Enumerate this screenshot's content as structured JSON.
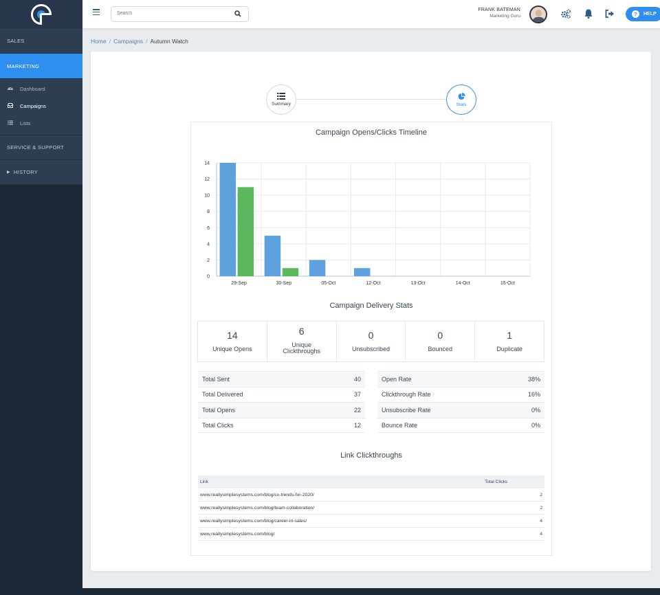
{
  "sidebar": {
    "sections": {
      "sales": "SALES",
      "marketing": "MARKETING",
      "service": "SERVICE & SUPPORT",
      "history": "HISTORY"
    },
    "marketing_items": [
      {
        "label": "Dashboard",
        "icon": "dashboard-icon"
      },
      {
        "label": "Campaigns",
        "icon": "inbox-icon"
      },
      {
        "label": "Lists",
        "icon": "list-icon"
      }
    ]
  },
  "topbar": {
    "search_placeholder": "Search",
    "user_name": "FRANK BATEMAN",
    "user_role": "Marketing Guru",
    "help_label": "HELP",
    "accent": "#2f8ff0"
  },
  "breadcrumb": {
    "home": "Home",
    "campaigns": "Campaigns",
    "current": "Autumn Watch"
  },
  "steps": {
    "summary": "Summary",
    "stats": "Stats"
  },
  "sections": {
    "timeline_title": "Campaign Opens/Clicks Timeline",
    "delivery_title": "Campaign Delivery Stats",
    "links_title": "Link Clickthroughs"
  },
  "chart_data": {
    "type": "bar",
    "categories": [
      "29-Sep",
      "30-Sep",
      "05-Oct",
      "12-Oct",
      "13-Oct",
      "14-Oct",
      "15-Oct"
    ],
    "series": [
      {
        "color": "#5da1de",
        "values": [
          14,
          5,
          2,
          1,
          0,
          0,
          0
        ]
      },
      {
        "color": "#5cb85c",
        "values": [
          11,
          1,
          0,
          0,
          0,
          0,
          0
        ]
      }
    ],
    "ylim": [
      0,
      14
    ],
    "yticks": [
      0,
      2,
      4,
      6,
      8,
      10,
      12,
      14
    ],
    "grid": true,
    "legend": "none"
  },
  "stat_boxes": [
    {
      "value": "14",
      "label": "Unique Opens"
    },
    {
      "value": "6",
      "label": "Unique Clickthroughs"
    },
    {
      "value": "0",
      "label": "Unsubscribed"
    },
    {
      "value": "0",
      "label": "Bounced"
    },
    {
      "value": "1",
      "label": "Duplicate"
    }
  ],
  "totals_left": [
    {
      "label": "Total Sent",
      "value": "40"
    },
    {
      "label": "Total Delivered",
      "value": "37"
    },
    {
      "label": "Total Opens",
      "value": "22"
    },
    {
      "label": "Total Clicks",
      "value": "12"
    }
  ],
  "totals_right": [
    {
      "label": "Open Rate",
      "value": "38%"
    },
    {
      "label": "Clickthrough Rate",
      "value": "16%"
    },
    {
      "label": "Unsubscribe Rate",
      "value": "0%"
    },
    {
      "label": "Bounce Rate",
      "value": "0%"
    }
  ],
  "links_table": {
    "header_link": "Link",
    "header_clicks": "Total Clicks",
    "rows": [
      {
        "url": "www.reallysimplesystems.com/blog/cx-trends-for-2020/",
        "clicks": "2"
      },
      {
        "url": "www.reallysimplesystems.com/blog/team-collaboration/",
        "clicks": "2"
      },
      {
        "url": "www.reallysimplesystems.com/blog/career-in-sales/",
        "clicks": "4"
      },
      {
        "url": "www.reallysimplesystems.com/blog/",
        "clicks": "4"
      }
    ]
  }
}
